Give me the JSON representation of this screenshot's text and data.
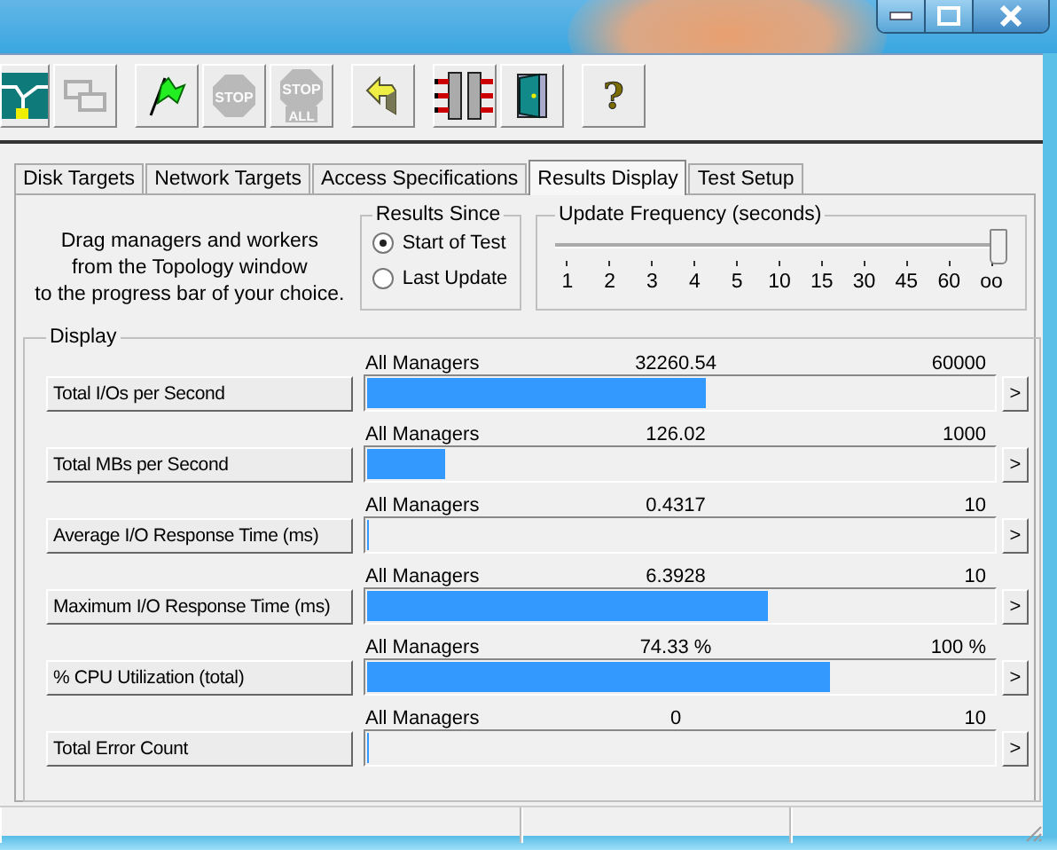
{
  "toolbar": [
    {
      "kind": "topology",
      "disabled": false
    },
    {
      "kind": "workers",
      "disabled": true
    },
    {
      "kind": "start",
      "disabled": false
    },
    {
      "kind": "stop",
      "disabled": true,
      "label": "STOP"
    },
    {
      "kind": "stopall",
      "disabled": true,
      "label": "STOP",
      "sublabel": "ALL"
    },
    {
      "kind": "reset",
      "disabled": false
    },
    {
      "kind": "network",
      "disabled": false
    },
    {
      "kind": "exit",
      "disabled": false
    },
    {
      "kind": "help",
      "disabled": false,
      "label": "?"
    }
  ],
  "tabs": [
    {
      "label": "Disk Targets",
      "selected": false
    },
    {
      "label": "Network Targets",
      "selected": false
    },
    {
      "label": "Access Specifications",
      "selected": false
    },
    {
      "label": "Results Display",
      "selected": true
    },
    {
      "label": "Test Setup",
      "selected": false
    }
  ],
  "instructions": [
    "Drag managers and workers",
    "from the Topology window",
    "to the progress bar of your choice."
  ],
  "results_since": {
    "title": "Results Since",
    "options": [
      {
        "label": "Start of Test",
        "selected": true
      },
      {
        "label": "Last Update",
        "selected": false
      }
    ]
  },
  "update_frequency": {
    "title": "Update Frequency (seconds)",
    "level": 1,
    "ticks": [
      "1",
      "2",
      "3",
      "4",
      "5",
      "10",
      "15",
      "30",
      "45",
      "60",
      "oo"
    ]
  },
  "display": {
    "title": "Display",
    "rows": [
      {
        "button": "Total I/Os per Second",
        "source": "All Managers",
        "value": "32260.54",
        "max": "60000",
        "level": 0.54,
        "more": ">"
      },
      {
        "button": "Total MBs per Second",
        "source": "All Managers",
        "value": "126.02",
        "max": "1000",
        "level": 0.126,
        "more": ">"
      },
      {
        "button": "Average I/O Response Time (ms)",
        "source": "All Managers",
        "value": "0.4317",
        "max": "10",
        "level": 0,
        "more": ">"
      },
      {
        "button": "Maximum I/O Response Time (ms)",
        "source": "All Managers",
        "value": "6.3928",
        "max": "10",
        "level": 0.64,
        "more": ">"
      },
      {
        "button": "% CPU Utilization (total)",
        "source": "All Managers",
        "value": "74.33 %",
        "max": "100 %",
        "level": 0.74,
        "more": ">"
      },
      {
        "button": "Total Error Count",
        "source": "All Managers",
        "value": "0",
        "max": "10",
        "level": 0,
        "more": ">"
      }
    ]
  }
}
